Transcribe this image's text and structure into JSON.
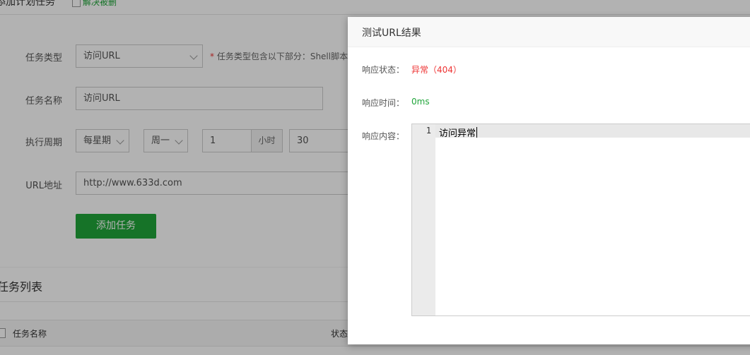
{
  "page": {
    "section_title": "添加计划任务",
    "checkbox_label": "解决被删",
    "form": {
      "task_type_label": "任务类型",
      "task_type_value": "访问URL",
      "task_type_hint_star": "*",
      "task_type_hint": "任务类型包含以下部分：Shell脚本",
      "task_name_label": "任务名称",
      "task_name_value": "访问URL",
      "period_label": "执行周期",
      "period_type": "每星期",
      "period_day": "周一",
      "hour_value": "1",
      "hour_unit": "小时",
      "minute_value": "30",
      "url_label": "URL地址",
      "url_value": "http://www.633d.com",
      "add_button": "添加任务"
    },
    "list": {
      "title": "任务列表",
      "columns": [
        "任务名称",
        "状态"
      ]
    }
  },
  "modal": {
    "title": "测试URL结果",
    "status_label": "响应状态：",
    "status_value": "异常（404）",
    "time_label": "响应时间：",
    "time_value": "0ms",
    "content_label": "响应内容：",
    "editor": {
      "line_number": "1",
      "content": "访问异常"
    }
  },
  "colors": {
    "accent": "#20a53a",
    "error": "#e33333"
  }
}
